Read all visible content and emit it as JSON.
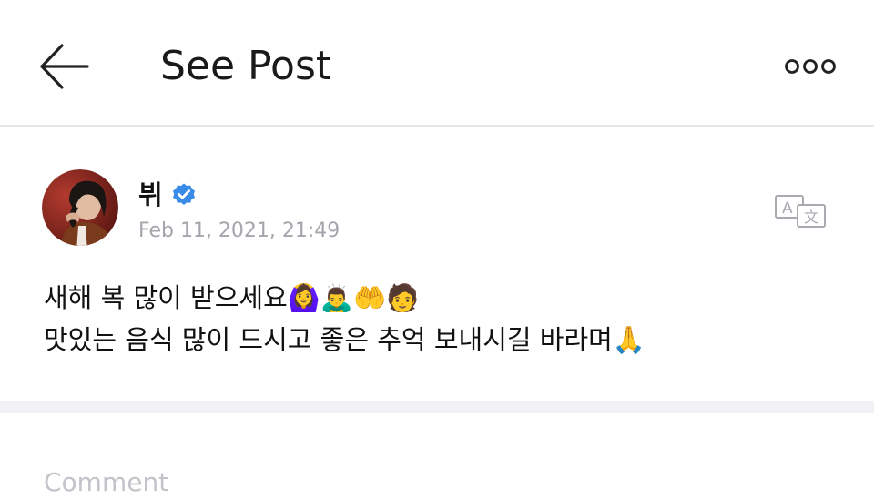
{
  "header": {
    "title": "See Post",
    "back_icon": "arrow-left-icon",
    "more_icon": "more-horizontal-icon"
  },
  "post": {
    "author": {
      "name": "뷔",
      "verified": true,
      "verified_icon": "verified-check-icon",
      "verified_color": "#3a8be8"
    },
    "timestamp": "Feb 11, 2021, 21:49",
    "translate_icon": "translate-icon",
    "body_lines": [
      "새해 복 많이 받으세요🙆‍♀️🙇‍♂️🤲🧑",
      "맛있는 음식 많이 드시고 좋은 추억 보내시길 바라며🙏"
    ]
  },
  "comment": {
    "placeholder": "Comment"
  }
}
